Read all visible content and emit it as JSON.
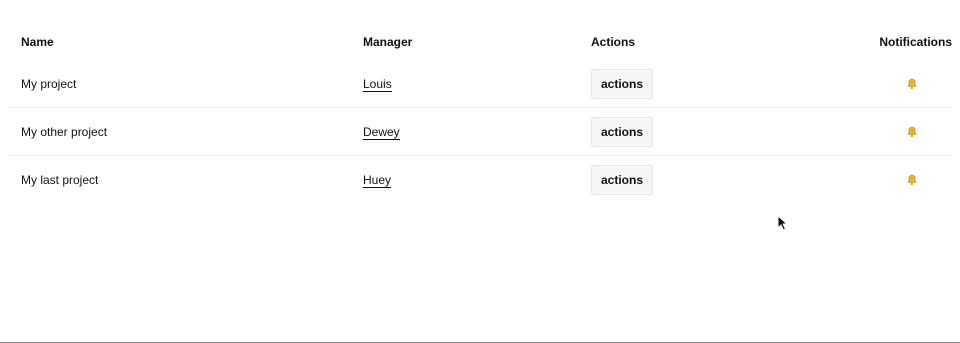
{
  "table": {
    "headers": {
      "name": "Name",
      "manager": "Manager",
      "actions": "Actions",
      "notifications": "Notifications"
    },
    "rows": [
      {
        "name": "My project",
        "manager": "Louis",
        "action_label": "actions",
        "notification_icon": "bell-icon"
      },
      {
        "name": "My other project",
        "manager": "Dewey",
        "action_label": "actions",
        "notification_icon": "bell-icon"
      },
      {
        "name": "My last project",
        "manager": "Huey",
        "action_label": "actions",
        "notification_icon": "bell-icon"
      }
    ]
  },
  "colors": {
    "bell": "#e8b422",
    "button_bg": "#f6f6f6",
    "row_divider": "#efefef"
  }
}
